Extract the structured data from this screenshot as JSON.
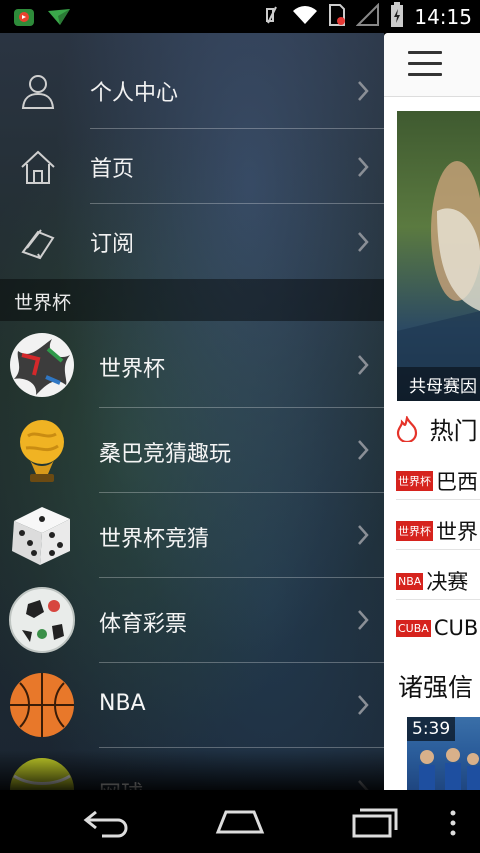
{
  "status_bar": {
    "time": "14:15",
    "icons": [
      "app-notification-icon",
      "download-icon",
      "mute-icon",
      "wifi-icon",
      "no-sim-icon",
      "signal-icon",
      "battery-icon"
    ]
  },
  "drawer": {
    "top_items": [
      {
        "label": "个人中心",
        "icon": "user-icon"
      },
      {
        "label": "首页",
        "icon": "home-icon"
      },
      {
        "label": "订阅",
        "icon": "book-icon"
      }
    ],
    "section_title": "世界杯",
    "list_items": [
      {
        "label": "世界杯",
        "icon": "soccer-ball-icon"
      },
      {
        "label": "桑巴竞猜趣玩",
        "icon": "trophy-icon"
      },
      {
        "label": "世界杯竞猜",
        "icon": "dice-icon"
      },
      {
        "label": "体育彩票",
        "icon": "lottery-ball-icon"
      },
      {
        "label": "NBA",
        "icon": "basketball-icon"
      },
      {
        "label": "网球",
        "icon": "tennis-ball-icon"
      }
    ]
  },
  "main": {
    "hero_caption": "共母赛因",
    "hot_label": "热门",
    "news": [
      {
        "tag": "世界杯",
        "title": "巴西"
      },
      {
        "tag": "世界杯",
        "title": "世界"
      },
      {
        "tag": "NBA",
        "title": "决赛"
      },
      {
        "tag": "CUBA",
        "title": "CUB"
      }
    ],
    "subhead": "诸强信",
    "video_duration": "5:39"
  },
  "colors": {
    "tag_red": "#d6231d",
    "flame_red": "#e5332a"
  }
}
